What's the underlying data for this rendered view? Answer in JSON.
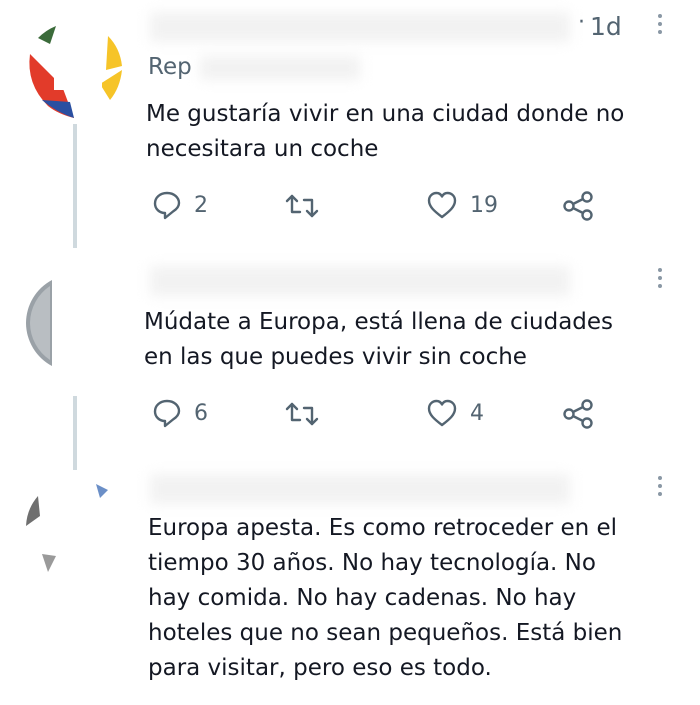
{
  "tweet1": {
    "time": "1d",
    "reply_prefix": "Rep",
    "text": "Me gustaría vivir en una ciudad donde no\nnecesitara un coche",
    "replies": "2",
    "retweets": "",
    "likes": "19"
  },
  "tweet2": {
    "text": "Múdate a Europa, está llena de ciudades\nen las que puedes vivir sin coche",
    "replies": "6",
    "retweets": "",
    "likes": "4"
  },
  "tweet3": {
    "text": "Europa apesta. Es como retroceder en el\ntiempo 30 años. No hay tecnología. No\nhay comida. No hay cadenas. No hay\nhoteles que no sean pequeños. Está bien\npara visitar, pero eso es todo."
  },
  "icons": {
    "reply": "reply-icon",
    "retweet": "retweet-icon",
    "like": "heart-icon",
    "share": "share-icon",
    "more": "more-vertical-icon"
  },
  "colors": {
    "text": "#141823",
    "muted": "#536471",
    "line": "#cfd9de"
  }
}
